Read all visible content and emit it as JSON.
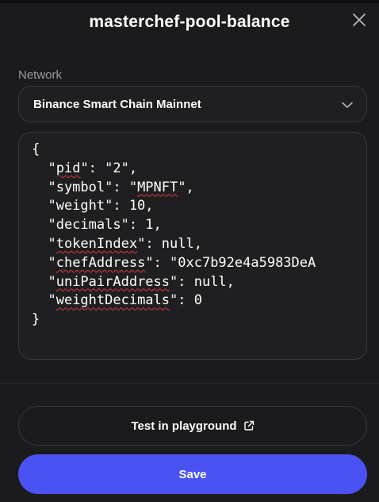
{
  "header": {
    "title": "masterchef-pool-balance",
    "close_icon": "close-icon"
  },
  "network": {
    "label": "Network",
    "selected": "Binance Smart Chain Mainnet",
    "chevron_icon": "chevron-down-icon"
  },
  "editor": {
    "lines": [
      "{",
      "  \"pid\": \"2\",",
      "  \"symbol\": \"MPNFT\",",
      "  \"weight\": 10,",
      "  \"decimals\": 1,",
      "  \"tokenIndex\": null,",
      "  \"chefAddress\": \"0xc7b92e4a5983DeA",
      "  \"uniPairAddress\": null,",
      "  \"weightDecimals\": 0",
      "}"
    ],
    "underlined_words": [
      "pid",
      "MPNFT",
      "tokenIndex",
      "chefAddress",
      "uniPairAddress",
      "weightDecimals"
    ]
  },
  "actions": {
    "test_label": "Test in playground",
    "test_icon": "external-link-icon",
    "save_label": "Save"
  },
  "colors": {
    "background": "#1b1b1d",
    "primary": "#4a52f3",
    "border": "#38383d",
    "muted_text": "#9a9aa2",
    "spellcheck": "#d9383e"
  }
}
